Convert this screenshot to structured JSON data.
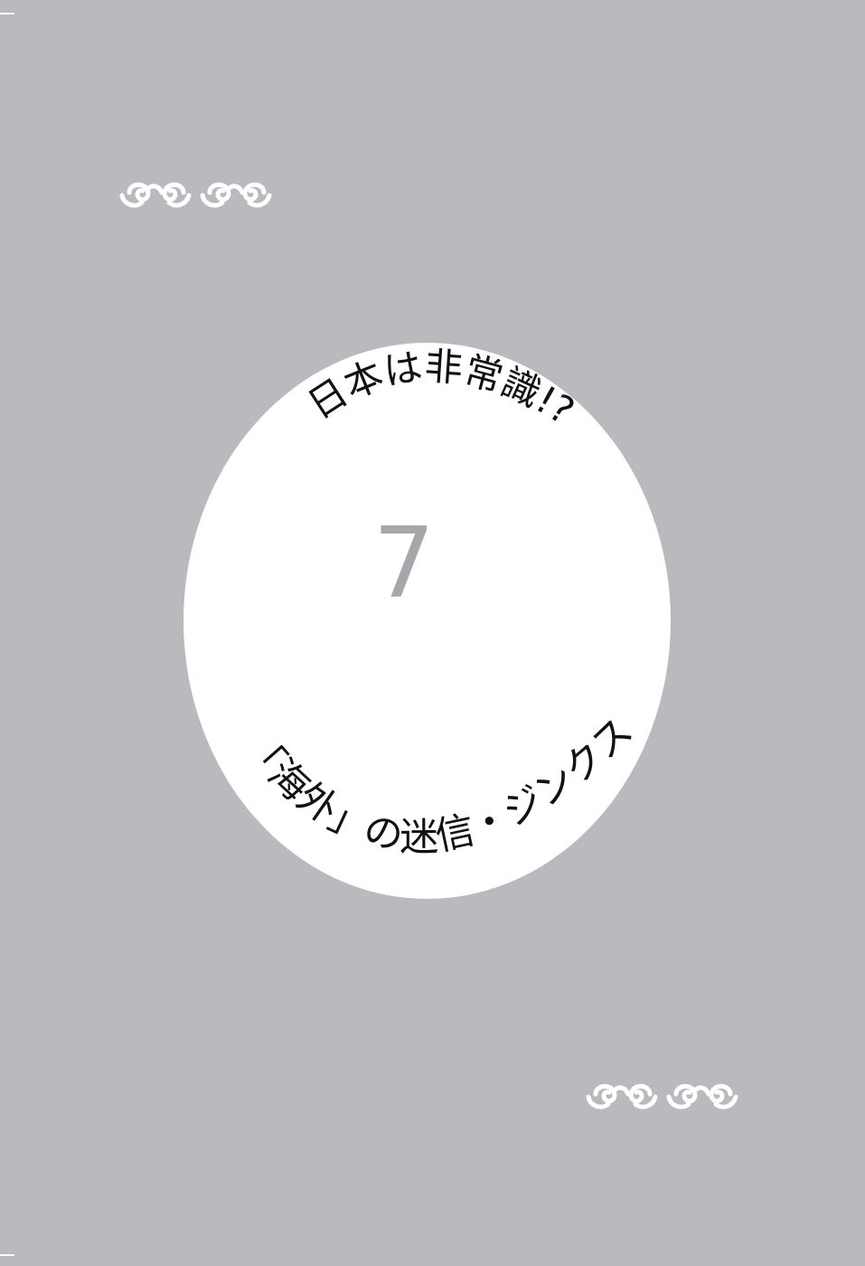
{
  "page": {
    "background": "#b9babe",
    "oval_fill": "#ffffff",
    "number_color": "#a6a7ab",
    "text_color": "#111111"
  },
  "ornaments": {
    "top": {
      "icon": "spiral-scroll-ornament",
      "count": 4
    },
    "bottom": {
      "icon": "spiral-scroll-ornament",
      "count": 4
    }
  },
  "chapter": {
    "number": "7",
    "title_top": "日本は非常識!?",
    "title_bottom": "「海外」の迷信・ジンクス"
  }
}
